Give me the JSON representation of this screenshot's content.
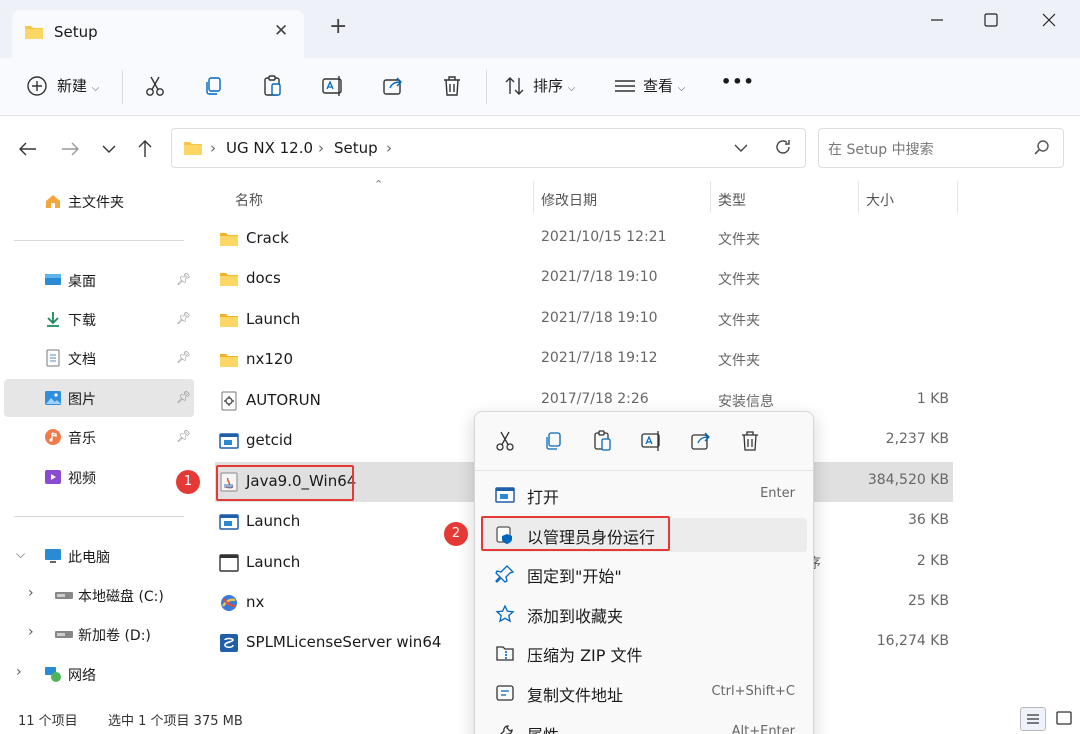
{
  "window": {
    "tab_title": "Setup",
    "tab_close": "✕",
    "new_tab": "+"
  },
  "toolbar": {
    "new_label": "新建",
    "sort_label": "排序",
    "view_label": "查看",
    "more_label": "•••"
  },
  "address": {
    "breadcrumb": [
      "UG NX 12.0",
      "Setup"
    ],
    "search_placeholder": "在 Setup 中搜索"
  },
  "sidebar": {
    "home": "主文件夹",
    "quick": [
      {
        "label": "桌面",
        "icon": "desktop-icon"
      },
      {
        "label": "下载",
        "icon": "download-icon"
      },
      {
        "label": "文档",
        "icon": "document-icon"
      },
      {
        "label": "图片",
        "icon": "pictures-icon"
      },
      {
        "label": "音乐",
        "icon": "music-icon"
      },
      {
        "label": "视频",
        "icon": "video-icon"
      }
    ],
    "this_pc": "此电脑",
    "drives": [
      "本地磁盘 (C:)",
      "新加卷 (D:)"
    ],
    "network": "网络"
  },
  "columns": {
    "name": "名称",
    "date": "修改日期",
    "type": "类型",
    "size": "大小"
  },
  "files": [
    {
      "name": "Crack",
      "date": "2021/10/15 12:21",
      "type": "文件夹",
      "size": "",
      "icon": "folder-icon"
    },
    {
      "name": "docs",
      "date": "2021/7/18 19:10",
      "type": "文件夹",
      "size": "",
      "icon": "folder-icon"
    },
    {
      "name": "Launch",
      "date": "2021/7/18 19:10",
      "type": "文件夹",
      "size": "",
      "icon": "folder-icon"
    },
    {
      "name": "nx120",
      "date": "2021/7/18 19:12",
      "type": "文件夹",
      "size": "",
      "icon": "folder-icon"
    },
    {
      "name": "AUTORUN",
      "date": "2017/7/18 2:26",
      "type": "安装信息",
      "size": "1 KB",
      "icon": "setup-info-icon"
    },
    {
      "name": "getcid",
      "date": "",
      "type": "",
      "size": "2,237 KB",
      "icon": "app-icon"
    },
    {
      "name": "Java9.0_Win64",
      "date": "",
      "type": "",
      "size": "384,520 KB",
      "icon": "java-installer-icon"
    },
    {
      "name": "Launch",
      "date": "",
      "type": "",
      "size": "36 KB",
      "icon": "app-icon"
    },
    {
      "name": "Launch",
      "date": "",
      "type": "序",
      "size": "2 KB",
      "icon": "window-icon"
    },
    {
      "name": "nx",
      "date": "",
      "type": "",
      "size": "25 KB",
      "icon": "nx-icon"
    },
    {
      "name": "SPLMLicenseServer win64",
      "date": "",
      "type": "",
      "size": "16,274 KB",
      "icon": "license-server-icon"
    }
  ],
  "status": {
    "count": "11 个项目",
    "selection": "选中 1 个项目  375 MB"
  },
  "context_menu": {
    "items": [
      {
        "label": "打开",
        "shortcut": "Enter",
        "icon": "open-icon"
      },
      {
        "label": "以管理员身份运行",
        "shortcut": "",
        "icon": "shield-icon"
      },
      {
        "label": "固定到\"开始\"",
        "shortcut": "",
        "icon": "pin-icon"
      },
      {
        "label": "添加到收藏夹",
        "shortcut": "",
        "icon": "star-icon"
      },
      {
        "label": "压缩为 ZIP 文件",
        "shortcut": "",
        "icon": "zip-icon"
      },
      {
        "label": "复制文件地址",
        "shortcut": "Ctrl+Shift+C",
        "icon": "copy-path-icon"
      },
      {
        "label": "属性",
        "shortcut": "Alt+Enter",
        "icon": "properties-icon"
      }
    ]
  },
  "annotations": {
    "badge1": "1",
    "badge2": "2"
  },
  "colors": {
    "accent": "#0067c0",
    "folder": "#f7c646",
    "annotation": "#e53935"
  }
}
